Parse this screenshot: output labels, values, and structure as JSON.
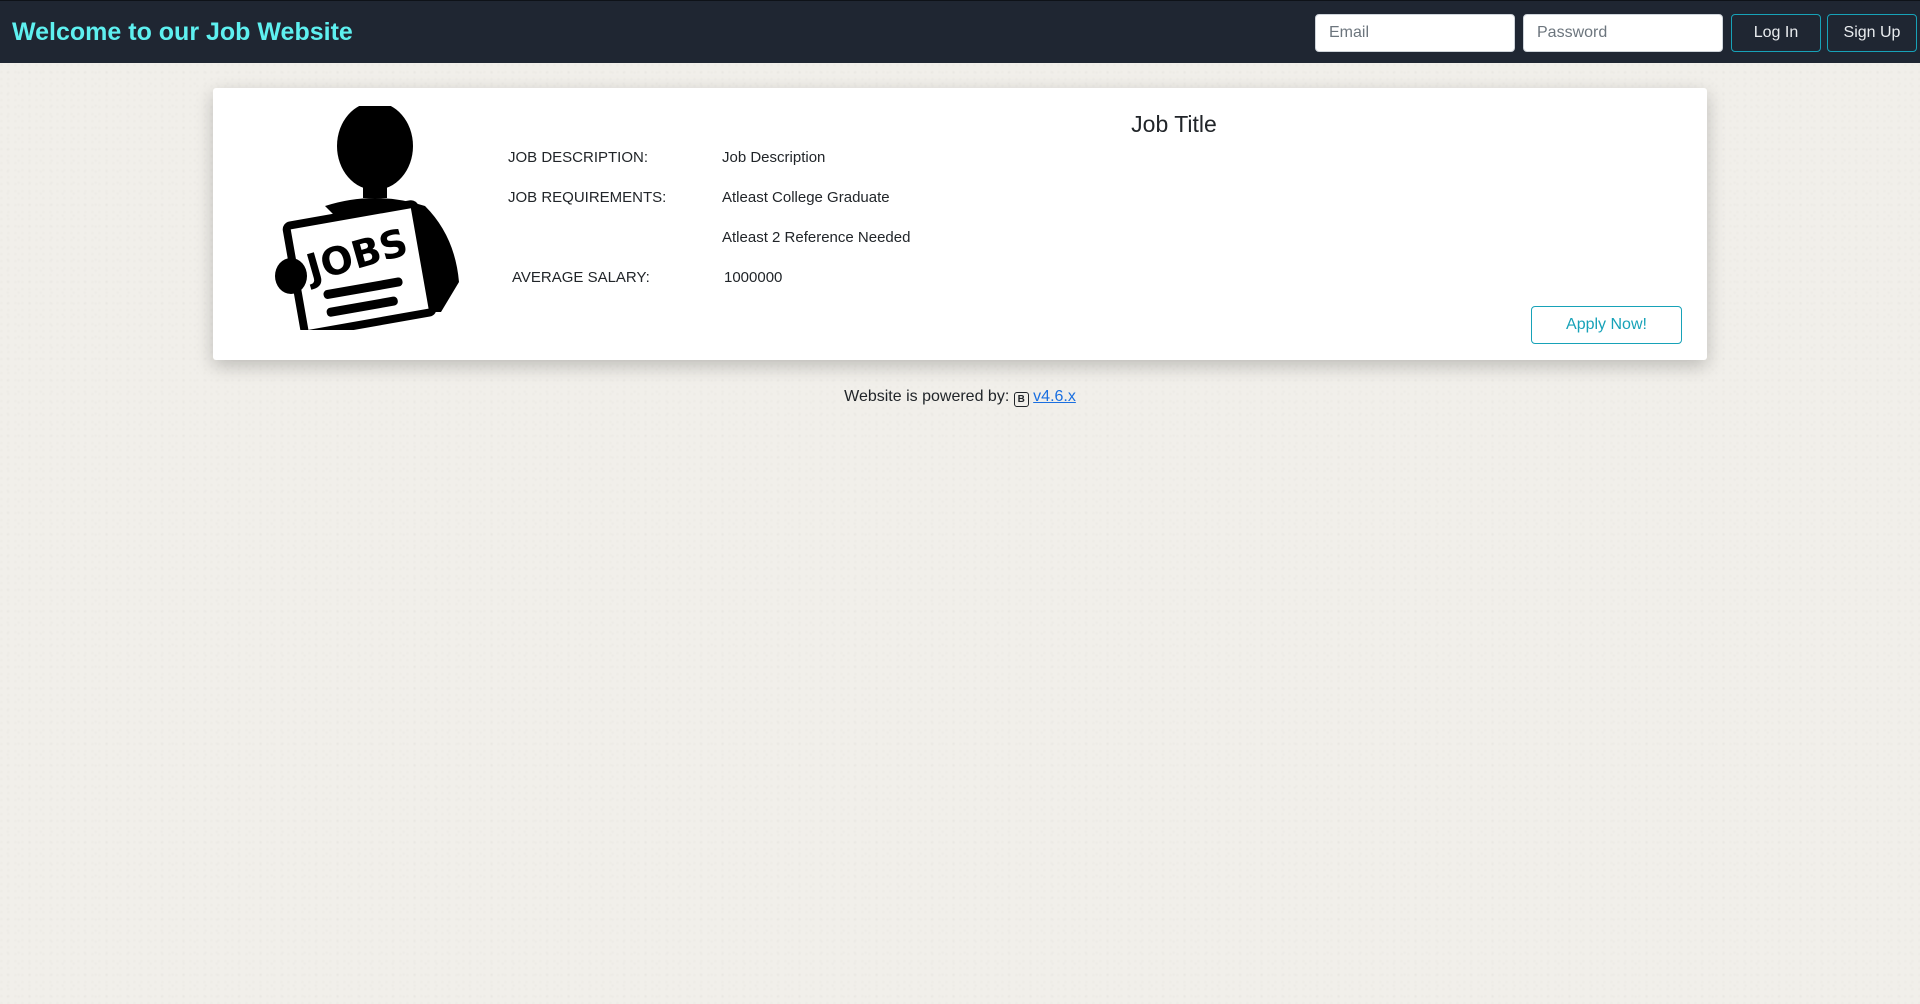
{
  "navbar": {
    "brand": "Welcome to our Job Website",
    "email_placeholder": "Email",
    "password_placeholder": "Password",
    "login_label": "Log In",
    "signup_label": "Sign Up"
  },
  "job_card": {
    "image_label": "JOBS",
    "title": "Job Title",
    "description_label": "JOB DESCRIPTION:",
    "description_value": "Job Description",
    "requirements_label": "JOB REQUIREMENTS:",
    "requirements": [
      "Atleast College Graduate",
      "Atleast 2 Reference Needed"
    ],
    "salary_label": "AVERAGE SALARY:",
    "salary_value": "1000000",
    "apply_label": "Apply Now!"
  },
  "footer": {
    "text": "Website is powered by:",
    "bootstrap_icon_glyph": "B",
    "version_link": "v4.6.x"
  },
  "colors": {
    "navbar_bg": "#1f2632",
    "brand": "#5ef0f0",
    "accent_info": "#17a2b8",
    "link": "#1a6fe0"
  }
}
